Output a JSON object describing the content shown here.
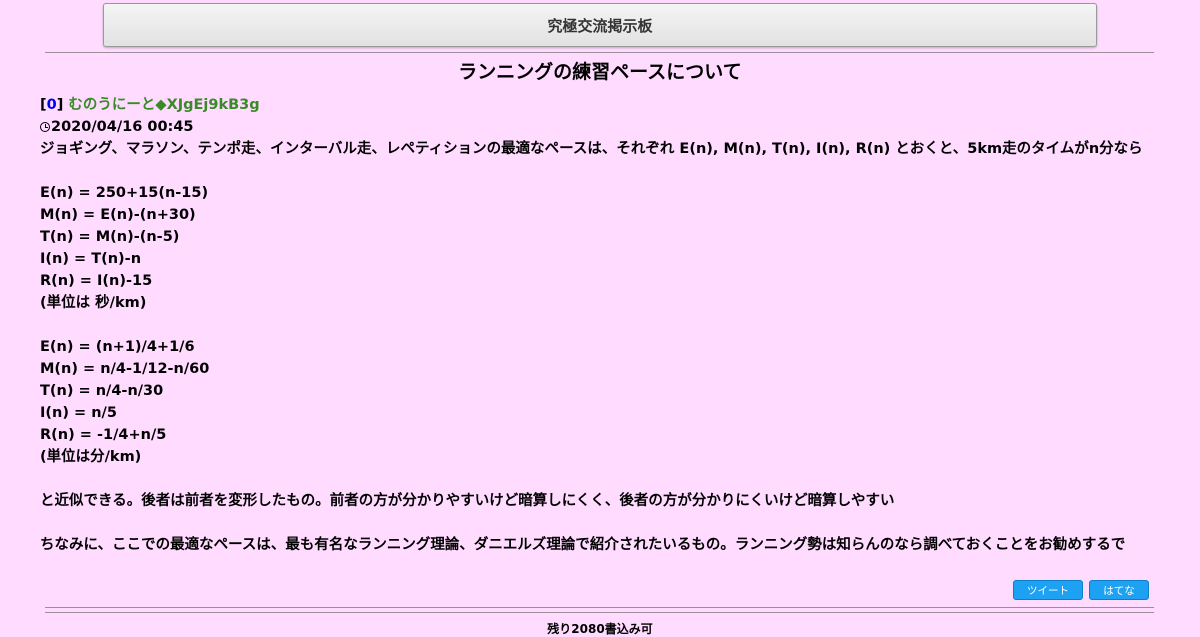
{
  "header": {
    "board_title": "究極交流掲示板"
  },
  "thread": {
    "title": "ランニングの練習ペースについて"
  },
  "post": {
    "number": "0",
    "author": "むのうにーと◆XJgEj9kB3g",
    "datetime": "2020/04/16 00:45",
    "lines": [
      "ジョギング、マラソン、テンポ走、インターバル走、レペティションの最適なペースは、それぞれ E(n), M(n), T(n), I(n), R(n) とおくと、5km走のタイムがn分なら",
      "",
      "E(n) = 250+15(n-15)",
      "M(n) = E(n)-(n+30)",
      "T(n) = M(n)-(n-5)",
      "I(n) = T(n)-n",
      "R(n) = I(n)-15",
      "(単位は 秒/km)",
      "",
      "E(n) = (n+1)/4+1/6",
      "M(n) = n/4-1/12-n/60",
      "T(n) = n/4-n/30",
      "I(n) = n/5",
      "R(n) = -1/4+n/5",
      "(単位は分/km)",
      "",
      "と近似できる。後者は前者を変形したもの。前者の方が分かりやすいけど暗算しにくく、後者の方が分かりにくいけど暗算しやすい",
      "",
      "ちなみに、ここでの最適なペースは、最も有名なランニング理論、ダニエルズ理論で紹介されたいるもの。ランニング勢は知らんのなら調べておくことをお勧めするで"
    ]
  },
  "share": {
    "tweet_label": "ツイート",
    "hatena_label": "はてな"
  },
  "footer": {
    "status_text": "残り2080書込み可"
  },
  "colors": {
    "background": "#ffdcff",
    "author": "#3a8a2a",
    "link": "#0000ee",
    "button": "#1da1f2"
  }
}
